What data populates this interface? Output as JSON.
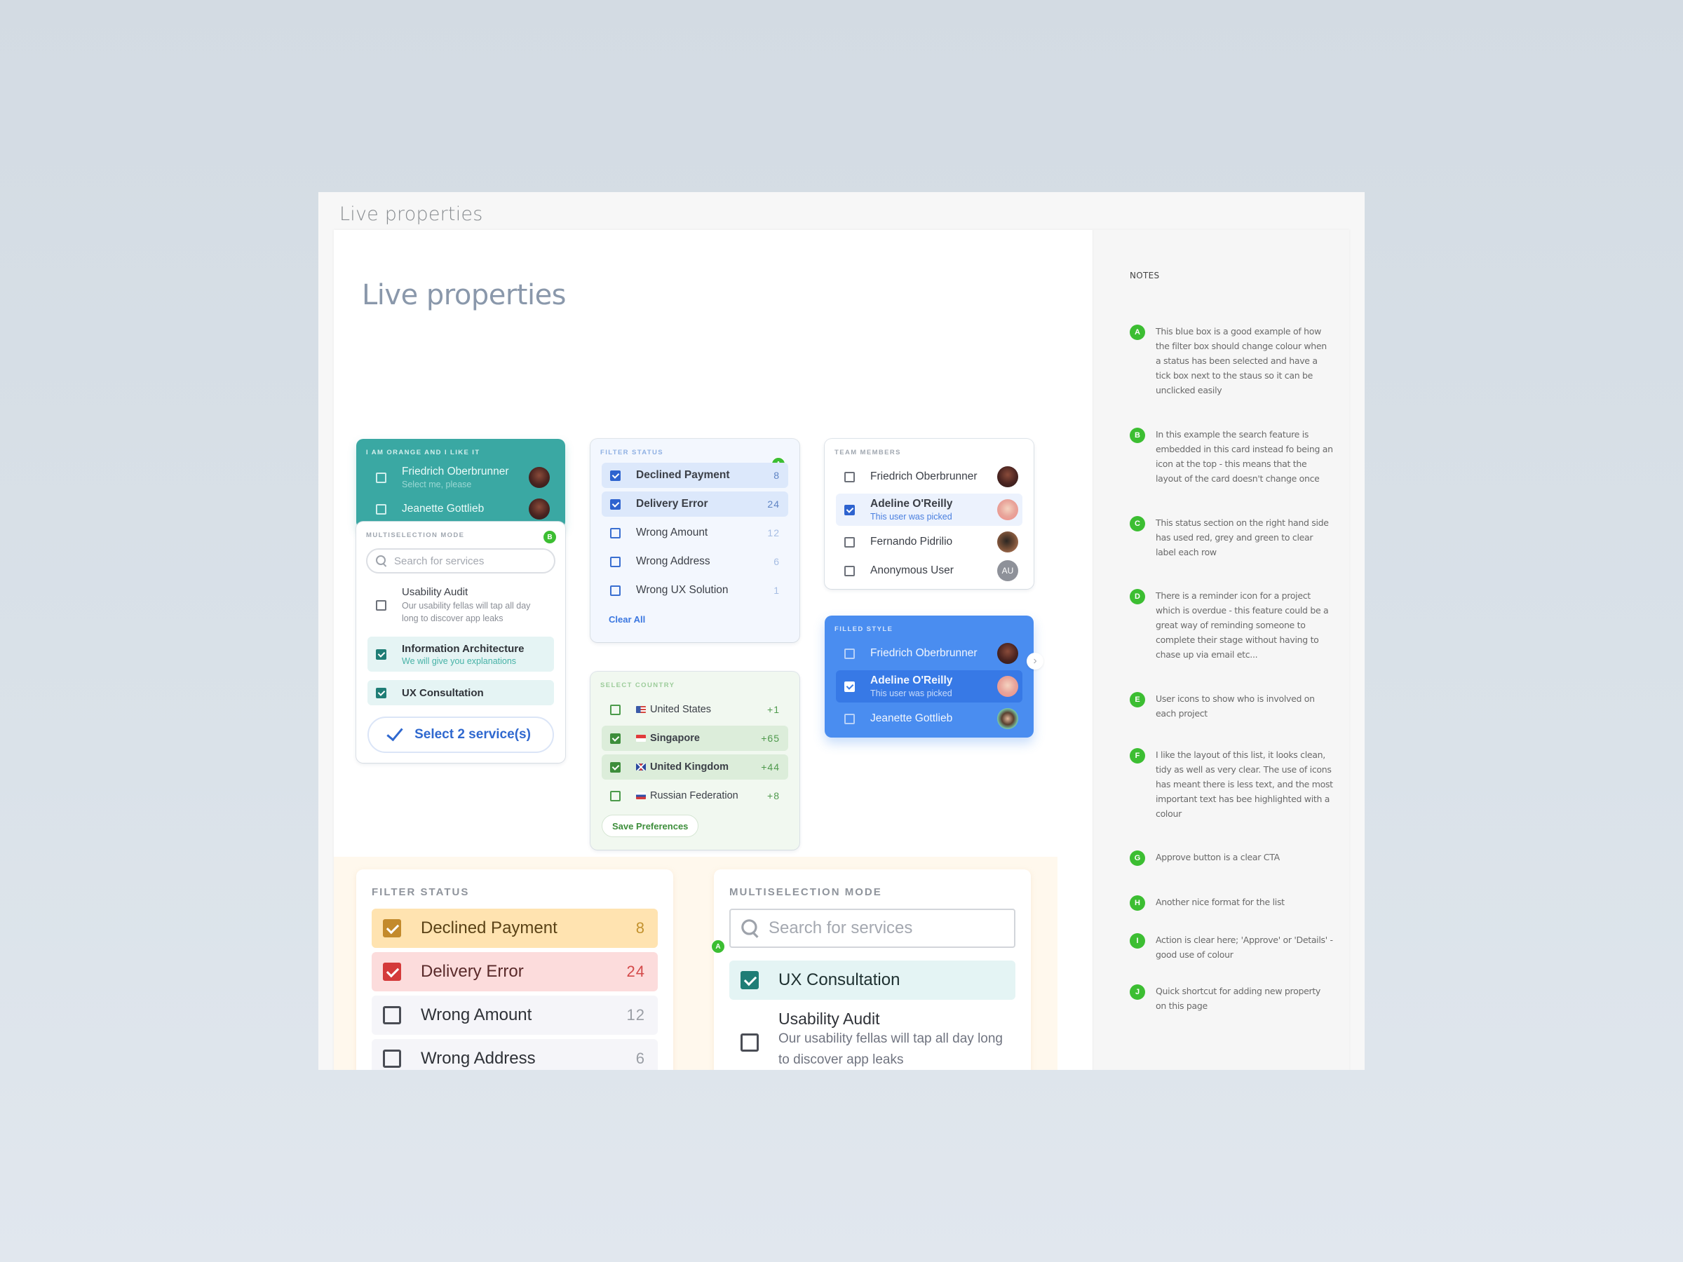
{
  "window": {
    "title": "Live properties"
  },
  "page": {
    "title": "Live properties"
  },
  "notes": {
    "title": "NOTES",
    "items": [
      {
        "badge": "A",
        "text": "This blue box is a good example of how the filter box should change colour when a status has been selected and have a tick box next to the staus so it can be unclicked easily"
      },
      {
        "badge": "B",
        "text": "In this example the search feature is embedded in this card instead fo being an icon at the top - this means that the layout of the card doesn't change once"
      },
      {
        "badge": "C",
        "text": "This status section on the right hand side has used red, grey and green to clear label each row"
      },
      {
        "badge": "D",
        "text": "There is a reminder icon for a project which is overdue - this feature could be a great way of reminding someone to complete their stage without having to chase up via email etc..."
      },
      {
        "badge": "E",
        "text": "User icons to show who is involved on each project"
      },
      {
        "badge": "F",
        "text": "I like the layout of this list, it looks clean, tidy as well as very clear. The use of icons has meant there is less text, and the most important text has bee highlighted with a colour"
      },
      {
        "badge": "G",
        "text": "Approve button is a clear CTA"
      },
      {
        "badge": "H",
        "text": "Another nice format for the list"
      },
      {
        "badge": "I",
        "text": "Action is clear here; 'Approve' or 'Details' - good use of colour"
      },
      {
        "badge": "J",
        "text": "Quick shortcut for adding new property on this page"
      }
    ]
  },
  "orange_card": {
    "label": "I AM ORANGE AND I LIKE IT",
    "items": [
      {
        "name": "Friedrich Oberbrunner",
        "sub": "Select me, please",
        "checked": false
      },
      {
        "name": "Jeanette Gottlieb",
        "checked": false
      }
    ]
  },
  "multiselect_small": {
    "label": "MULTISELECTION MODE",
    "badge": "B",
    "search_placeholder": "Search for services",
    "items": [
      {
        "name": "Usability Audit",
        "sub": "Our usability fellas will tap all day long to discover app leaks",
        "checked": false
      },
      {
        "name": "Information Architecture",
        "sub": "We will give you explanations",
        "checked": true
      },
      {
        "name": "UX Consultation",
        "checked": true
      }
    ],
    "button": "Select 2 service(s)"
  },
  "filter_status": {
    "label": "FILTER STATUS",
    "badge": "A",
    "items": [
      {
        "name": "Declined Payment",
        "count": "8",
        "checked": true
      },
      {
        "name": "Delivery Error",
        "count": "24",
        "checked": true
      },
      {
        "name": "Wrong Amount",
        "count": "12",
        "checked": false
      },
      {
        "name": "Wrong Address",
        "count": "6",
        "checked": false
      },
      {
        "name": "Wrong UX Solution",
        "count": "1",
        "checked": false
      }
    ],
    "clear_label": "Clear All"
  },
  "select_country": {
    "label": "SELECT COUNTRY",
    "items": [
      {
        "name": "United States",
        "count": "+1",
        "flag": "us",
        "checked": false
      },
      {
        "name": "Singapore",
        "count": "+65",
        "flag": "sg",
        "checked": true
      },
      {
        "name": "United Kingdom",
        "count": "+44",
        "flag": "uk",
        "checked": true
      },
      {
        "name": "Russian Federation",
        "count": "+8",
        "flag": "ru",
        "checked": false
      }
    ],
    "button": "Save Preferences"
  },
  "team_members": {
    "label": "TEAM MEMBERS",
    "items": [
      {
        "name": "Friedrich Oberbrunner",
        "checked": false
      },
      {
        "name": "Adeline O'Reilly",
        "sub": "This user was picked",
        "checked": true
      },
      {
        "name": "Fernando Pidrilio",
        "checked": false
      },
      {
        "name": "Anonymous User",
        "initials": "AU",
        "checked": false
      }
    ]
  },
  "filled_style": {
    "label": "FILLED STYLE",
    "items": [
      {
        "name": "Friedrich Oberbrunner",
        "checked": false
      },
      {
        "name": "Adeline O'Reilly",
        "sub": "This user was picked",
        "checked": true
      },
      {
        "name": "Jeanette Gottlieb",
        "checked": false
      }
    ],
    "next_icon": "chevron-right"
  },
  "big_filter": {
    "label": "FILTER STATUS",
    "items": [
      {
        "name": "Declined Payment",
        "count": "8",
        "checked": true,
        "color": "#f3b63a"
      },
      {
        "name": "Delivery Error",
        "count": "24",
        "checked": true,
        "color": "#de3b3b"
      },
      {
        "name": "Wrong Amount",
        "count": "12",
        "checked": false
      },
      {
        "name": "Wrong Address",
        "count": "6",
        "checked": false
      }
    ]
  },
  "big_multiselect": {
    "label": "MULTISELECTION MODE",
    "badge": "A",
    "search_placeholder": "Search for services",
    "items": [
      {
        "name": "UX Consultation",
        "checked": true
      },
      {
        "name": "Usability Audit",
        "sub": "Our usability fellas will tap all day long to discover app leaks",
        "checked": false
      }
    ]
  },
  "colors": {
    "teal": "#3aa8a3",
    "blue_accent": "#2e63cf",
    "filled_blue": "#4a8df0",
    "green_badge": "#3cbe32",
    "country_green": "#3d8e3b",
    "warning_orange": "#f3b63a",
    "error_red": "#de3b3b"
  }
}
